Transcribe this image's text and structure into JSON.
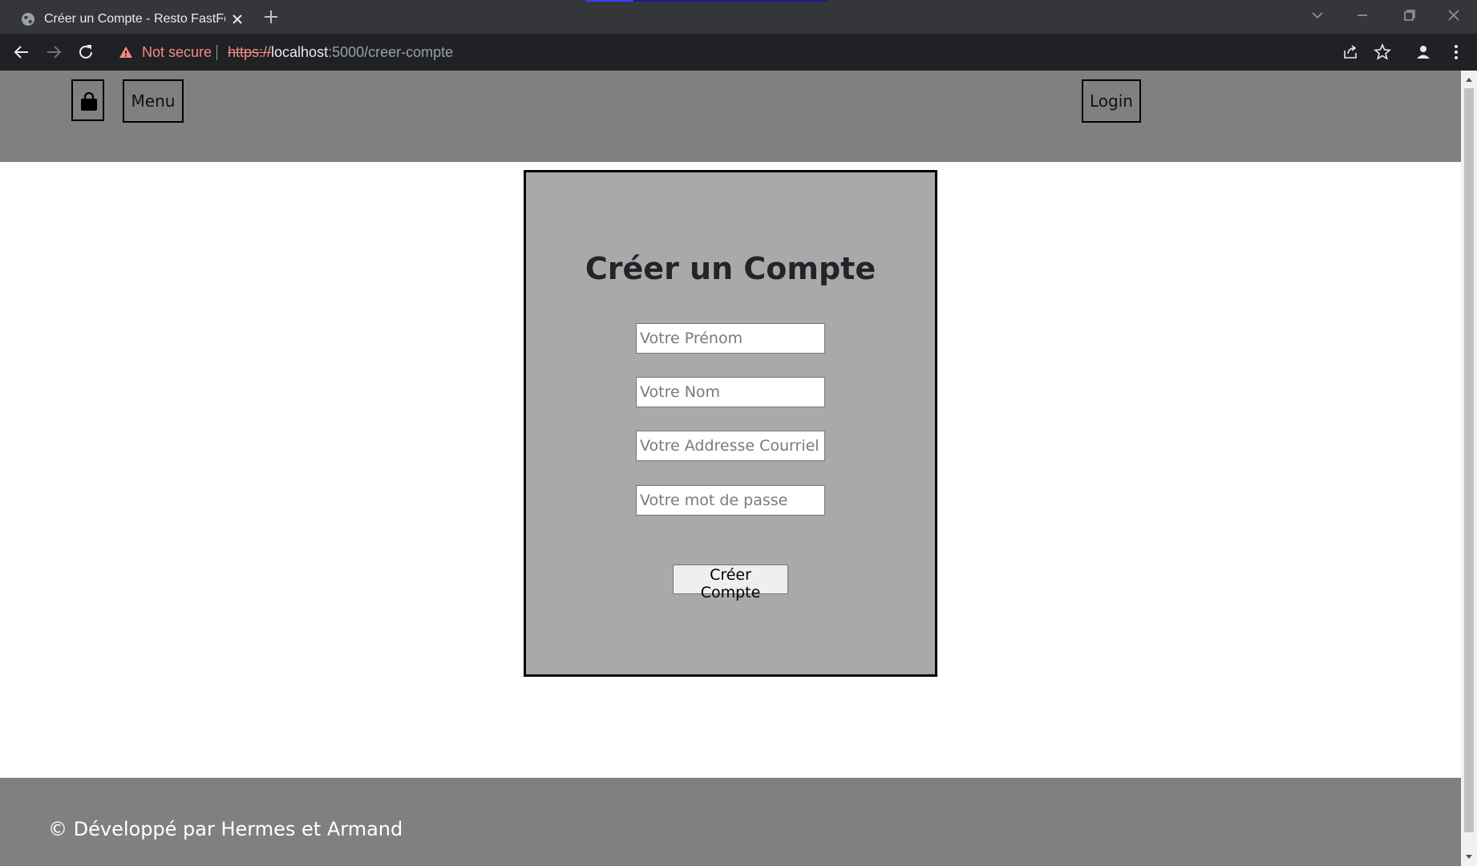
{
  "browser": {
    "tab_title": "Créer un Compte - Resto FastFoo",
    "security_label": "Not secure",
    "url_scheme": "https://",
    "url_host": "localhost",
    "url_path": ":5000/creer-compte"
  },
  "header": {
    "menu_label": "Menu",
    "login_label": "Login"
  },
  "form": {
    "title": "Créer un Compte",
    "first_name_placeholder": "Votre Prénom",
    "first_name_value": "",
    "last_name_placeholder": "Votre Nom",
    "last_name_value": "",
    "email_placeholder": "Votre Addresse Courriel",
    "email_value": "",
    "password_placeholder": "Votre mot de passe",
    "password_value": "",
    "submit_label": "Créer Compte"
  },
  "footer": {
    "copyright": "© Développé par Hermes et Armand"
  },
  "colors": {
    "header_bg": "#808080",
    "card_bg": "#a9a9a9",
    "footer_bg": "#808080",
    "warning_red": "#f28b82"
  },
  "icons": [
    "globe-icon",
    "close-icon",
    "plus-icon",
    "back-icon",
    "forward-icon",
    "reload-icon",
    "warning-icon",
    "share-icon",
    "star-icon",
    "profile-icon",
    "kebab-menu-icon",
    "shopping-bag-icon"
  ]
}
